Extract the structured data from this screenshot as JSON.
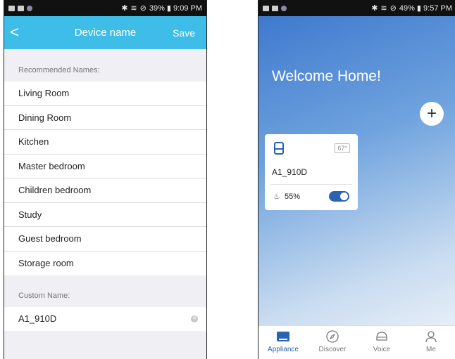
{
  "left_phone": {
    "status": {
      "right_text": "39% ▮ 9:09 PM"
    },
    "nav": {
      "back_glyph": "<",
      "title": "Device name",
      "save_label": "Save"
    },
    "recommended_label": "Recommended Names:",
    "names": [
      {
        "label": "Living Room"
      },
      {
        "label": "Dining Room"
      },
      {
        "label": "Kitchen"
      },
      {
        "label": "Master bedroom"
      },
      {
        "label": "Children bedroom"
      },
      {
        "label": "Study"
      },
      {
        "label": "Guest bedroom"
      },
      {
        "label": "Storage room"
      }
    ],
    "custom_label": "Custom Name:",
    "custom_value": "A1_910D"
  },
  "right_phone": {
    "status": {
      "right_text": "49% ▮ 9:57 PM"
    },
    "welcome": "Welcome Home!",
    "add_glyph": "+",
    "device": {
      "temp": "67°",
      "name": "A1_910D",
      "humidity": "55%",
      "power_on": true
    },
    "tabs": [
      {
        "label": "Appliance",
        "icon": "appliance-icon",
        "active": true
      },
      {
        "label": "Discover",
        "icon": "compass-icon",
        "active": false
      },
      {
        "label": "Voice",
        "icon": "voice-icon",
        "active": false
      },
      {
        "label": "Me",
        "icon": "user-icon",
        "active": false
      }
    ]
  },
  "colors": {
    "nav_blue": "#3dbde8",
    "accent": "#2b63b3"
  }
}
